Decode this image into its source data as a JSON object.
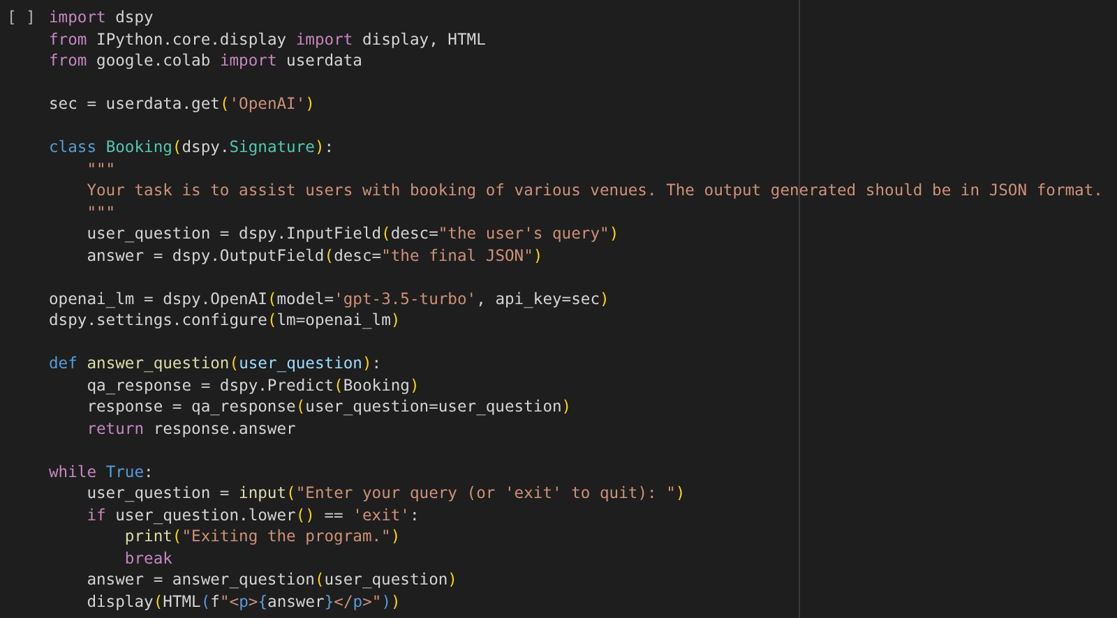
{
  "cell": {
    "execution_marker": "[ ]",
    "lines": [
      {
        "kind": "code",
        "tokens": [
          {
            "kind": "keyword",
            "text": "import"
          },
          {
            "kind": "plain",
            "text": " dspy"
          }
        ]
      },
      {
        "kind": "code",
        "tokens": [
          {
            "kind": "keyword",
            "text": "from"
          },
          {
            "kind": "plain",
            "text": " IPython.core.display "
          },
          {
            "kind": "keyword",
            "text": "import"
          },
          {
            "kind": "plain",
            "text": " display, HTML"
          }
        ]
      },
      {
        "kind": "code",
        "tokens": [
          {
            "kind": "keyword",
            "text": "from"
          },
          {
            "kind": "plain",
            "text": " google.colab "
          },
          {
            "kind": "keyword",
            "text": "import"
          },
          {
            "kind": "plain",
            "text": " userdata"
          }
        ]
      },
      {
        "kind": "blank"
      },
      {
        "kind": "code",
        "tokens": [
          {
            "kind": "plain",
            "text": "sec = userdata.get"
          },
          {
            "kind": "paren",
            "text": "("
          },
          {
            "kind": "string",
            "text": "'OpenAI'"
          },
          {
            "kind": "paren",
            "text": ")"
          }
        ]
      },
      {
        "kind": "blank"
      },
      {
        "kind": "code",
        "tokens": [
          {
            "kind": "storage",
            "text": "class "
          },
          {
            "kind": "type",
            "text": "Booking"
          },
          {
            "kind": "paren",
            "text": "("
          },
          {
            "kind": "plain",
            "text": "dspy."
          },
          {
            "kind": "type",
            "text": "Signature"
          },
          {
            "kind": "paren",
            "text": ")"
          },
          {
            "kind": "plain",
            "text": ":"
          }
        ]
      },
      {
        "kind": "code",
        "tokens": [
          {
            "kind": "string",
            "text": "    \"\"\""
          }
        ]
      },
      {
        "kind": "code",
        "tokens": [
          {
            "kind": "string",
            "text": "    Your task is to assist users with booking of various venues. The output generated should be in JSON format."
          }
        ]
      },
      {
        "kind": "code",
        "tokens": [
          {
            "kind": "string",
            "text": "    \"\"\""
          }
        ]
      },
      {
        "kind": "code",
        "tokens": [
          {
            "kind": "plain",
            "text": "    user_question = dspy.InputField"
          },
          {
            "kind": "paren",
            "text": "("
          },
          {
            "kind": "plain",
            "text": "desc="
          },
          {
            "kind": "string",
            "text": "\"the user's query\""
          },
          {
            "kind": "paren",
            "text": ")"
          }
        ]
      },
      {
        "kind": "code",
        "tokens": [
          {
            "kind": "plain",
            "text": "    answer = dspy.OutputField"
          },
          {
            "kind": "paren",
            "text": "("
          },
          {
            "kind": "plain",
            "text": "desc="
          },
          {
            "kind": "string",
            "text": "\"the final JSON\""
          },
          {
            "kind": "paren",
            "text": ")"
          }
        ]
      },
      {
        "kind": "blank"
      },
      {
        "kind": "code",
        "tokens": [
          {
            "kind": "plain",
            "text": "openai_lm = dspy.OpenAI"
          },
          {
            "kind": "paren",
            "text": "("
          },
          {
            "kind": "plain",
            "text": "model="
          },
          {
            "kind": "string",
            "text": "'gpt-3.5-turbo'"
          },
          {
            "kind": "plain",
            "text": ", api_key=sec"
          },
          {
            "kind": "paren",
            "text": ")"
          }
        ]
      },
      {
        "kind": "code",
        "tokens": [
          {
            "kind": "plain",
            "text": "dspy.settings.configure"
          },
          {
            "kind": "paren",
            "text": "("
          },
          {
            "kind": "plain",
            "text": "lm=openai_lm"
          },
          {
            "kind": "paren",
            "text": ")"
          }
        ]
      },
      {
        "kind": "blank"
      },
      {
        "kind": "code",
        "tokens": [
          {
            "kind": "storage",
            "text": "def "
          },
          {
            "kind": "function",
            "text": "answer_question"
          },
          {
            "kind": "paren",
            "text": "("
          },
          {
            "kind": "parameter",
            "text": "user_question"
          },
          {
            "kind": "paren",
            "text": ")"
          },
          {
            "kind": "plain",
            "text": ":"
          }
        ]
      },
      {
        "kind": "code",
        "tokens": [
          {
            "kind": "plain",
            "text": "    qa_response = dspy.Predict"
          },
          {
            "kind": "paren",
            "text": "("
          },
          {
            "kind": "plain",
            "text": "Booking"
          },
          {
            "kind": "paren",
            "text": ")"
          }
        ]
      },
      {
        "kind": "code",
        "tokens": [
          {
            "kind": "plain",
            "text": "    response = qa_response"
          },
          {
            "kind": "paren",
            "text": "("
          },
          {
            "kind": "plain",
            "text": "user_question=user_question"
          },
          {
            "kind": "paren",
            "text": ")"
          }
        ]
      },
      {
        "kind": "code",
        "tokens": [
          {
            "kind": "keyword",
            "text": "    return"
          },
          {
            "kind": "plain",
            "text": " response.answer"
          }
        ]
      },
      {
        "kind": "blank"
      },
      {
        "kind": "code",
        "tokens": [
          {
            "kind": "keyword",
            "text": "while "
          },
          {
            "kind": "storage",
            "text": "True"
          },
          {
            "kind": "plain",
            "text": ":"
          }
        ]
      },
      {
        "kind": "code",
        "tokens": [
          {
            "kind": "plain",
            "text": "    user_question = "
          },
          {
            "kind": "function",
            "text": "input"
          },
          {
            "kind": "paren",
            "text": "("
          },
          {
            "kind": "string",
            "text": "\"Enter your query (or 'exit' to quit): \""
          },
          {
            "kind": "paren",
            "text": ")"
          }
        ]
      },
      {
        "kind": "code",
        "tokens": [
          {
            "kind": "keyword",
            "text": "    if"
          },
          {
            "kind": "plain",
            "text": " user_question.lower"
          },
          {
            "kind": "paren",
            "text": "()"
          },
          {
            "kind": "plain",
            "text": " == "
          },
          {
            "kind": "string",
            "text": "'exit'"
          },
          {
            "kind": "plain",
            "text": ":"
          }
        ]
      },
      {
        "kind": "code",
        "tokens": [
          {
            "kind": "function",
            "text": "        print"
          },
          {
            "kind": "paren",
            "text": "("
          },
          {
            "kind": "string",
            "text": "\"Exiting the program.\""
          },
          {
            "kind": "paren",
            "text": ")"
          }
        ]
      },
      {
        "kind": "code",
        "tokens": [
          {
            "kind": "keyword",
            "text": "        break"
          }
        ]
      },
      {
        "kind": "code",
        "tokens": [
          {
            "kind": "plain",
            "text": "    answer = answer_question"
          },
          {
            "kind": "paren",
            "text": "("
          },
          {
            "kind": "plain",
            "text": "user_question"
          },
          {
            "kind": "paren",
            "text": ")"
          }
        ]
      },
      {
        "kind": "code",
        "tokens": [
          {
            "kind": "plain",
            "text": "    display"
          },
          {
            "kind": "paren",
            "text": "("
          },
          {
            "kind": "plain",
            "text": "HTML"
          },
          {
            "kind": "paren2",
            "text": "("
          },
          {
            "kind": "plain",
            "text": "f"
          },
          {
            "kind": "string",
            "text": "\"<"
          },
          {
            "kind": "tag",
            "text": "p"
          },
          {
            "kind": "string",
            "text": ">"
          },
          {
            "kind": "tag",
            "text": "{"
          },
          {
            "kind": "plain",
            "text": "answer"
          },
          {
            "kind": "tag",
            "text": "}"
          },
          {
            "kind": "string",
            "text": "</"
          },
          {
            "kind": "tag",
            "text": "p"
          },
          {
            "kind": "string",
            "text": ">\""
          },
          {
            "kind": "paren2",
            "text": ")"
          },
          {
            "kind": "paren",
            "text": ")"
          }
        ]
      }
    ]
  }
}
